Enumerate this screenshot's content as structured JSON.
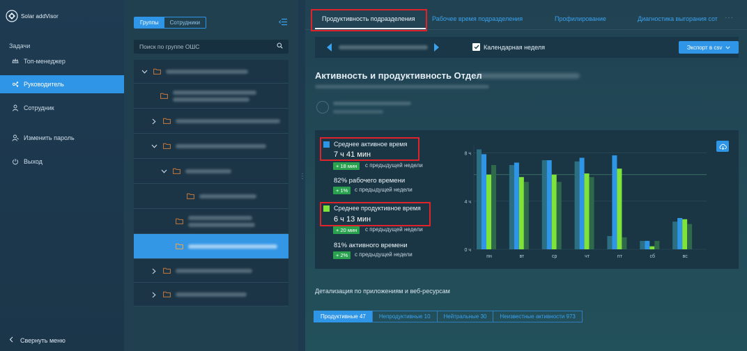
{
  "app": {
    "logo_text": "Solar addVisor"
  },
  "sidebar": {
    "section": "Задачи",
    "items": [
      {
        "label": "Топ-менеджер",
        "icon": "crown-icon",
        "active": false
      },
      {
        "label": "Руководитель",
        "icon": "org-icon",
        "active": true
      },
      {
        "label": "Сотрудник",
        "icon": "user-icon",
        "active": false
      },
      {
        "label": "Изменить пароль",
        "icon": "key-user-icon",
        "active": false
      },
      {
        "label": "Выход",
        "icon": "power-icon",
        "active": false
      }
    ],
    "collapse_label": "Свернуть меню"
  },
  "tree": {
    "segments": [
      "Группы",
      "Сотрудники"
    ],
    "active_segment": "Группы",
    "search_placeholder": "Поиск по группе ОШС"
  },
  "tabs": {
    "items": [
      {
        "label": "Продуктивность подразделения",
        "active": true
      },
      {
        "label": "Рабочее время подразделения",
        "active": false
      },
      {
        "label": "Профилирование",
        "active": false
      },
      {
        "label": "Диагностика выгорания сот",
        "active": false
      }
    ],
    "more": "···"
  },
  "toolbar": {
    "calendar_week_label": "Календарная неделя",
    "calendar_week_checked": true,
    "export_label": "Экспорт в csv"
  },
  "page": {
    "heading": "Активность и продуктивность Отдел"
  },
  "stats": {
    "active": {
      "label": "Среднее активное время",
      "value": "7 ч 41 мин",
      "delta": "+ 18 мин",
      "delta_note": "с предыдущей недели",
      "share": "82% рабочего времени",
      "share_delta": "+ 1%",
      "share_note": "с предыдущей недели",
      "color": "#2f95e6"
    },
    "productive": {
      "label": "Среднее продуктивное время",
      "value": "6 ч 13 мин",
      "delta": "+ 20 мин",
      "delta_note": "с предыдущей недели",
      "share": "81% активного времени",
      "share_delta": "+ 2%",
      "share_note": "с предыдущей недели",
      "color": "#7fe33a"
    }
  },
  "chart_data": {
    "type": "bar",
    "categories": [
      "пн",
      "вт",
      "ср",
      "чт",
      "пт",
      "сб",
      "вс"
    ],
    "yticks": [
      "0 ч",
      "4 ч",
      "8 ч"
    ],
    "ylim": [
      0,
      8.5
    ],
    "reference_line": 6.2,
    "series": [
      {
        "name": "",
        "color": "#2c6f82",
        "values": [
          8.3,
          7.0,
          7.4,
          7.3,
          1.1,
          0.7,
          2.3
        ]
      },
      {
        "name": "",
        "color": "#2f95e6",
        "values": [
          7.9,
          7.2,
          7.4,
          7.6,
          7.8,
          0.7,
          2.6
        ]
      },
      {
        "name": "",
        "color": "#7fe33a",
        "values": [
          6.2,
          6.0,
          6.2,
          6.3,
          6.7,
          0.25,
          2.5
        ]
      },
      {
        "name": "",
        "color": "#2e6a4a",
        "values": [
          7.0,
          5.6,
          5.6,
          6.0,
          1.0,
          0.7,
          2.1
        ]
      }
    ]
  },
  "detail": {
    "title": "Детализация по приложениям и веб-ресурсам",
    "chips": [
      {
        "label": "Продуктивные 47",
        "active": true
      },
      {
        "label": "Непродуктивные 10",
        "active": false
      },
      {
        "label": "Нейтральные 30",
        "active": false
      },
      {
        "label": "Неизвестные активности 973",
        "active": false
      }
    ]
  }
}
